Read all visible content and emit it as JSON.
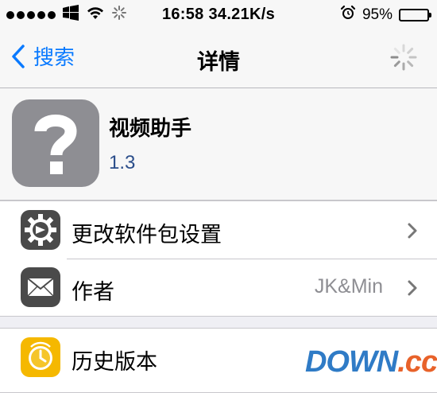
{
  "status_bar": {
    "time": "16:58",
    "speed": "34.21K/s",
    "battery_text": "95%",
    "battery_level": 0.95
  },
  "nav": {
    "back_label": "搜索",
    "title": "详情"
  },
  "package": {
    "name": "视频助手",
    "version": "1.3"
  },
  "sections": {
    "settings": {
      "label": "更改软件包设置"
    },
    "author": {
      "label": "作者",
      "value": "JK&Min"
    },
    "history": {
      "label": "历史版本"
    }
  },
  "watermark": {
    "left": "DOWN",
    "right": ".cc"
  },
  "colors": {
    "accent": "#0a7aff",
    "version": "#2a4d8a",
    "history_icon": "#f5b800"
  }
}
